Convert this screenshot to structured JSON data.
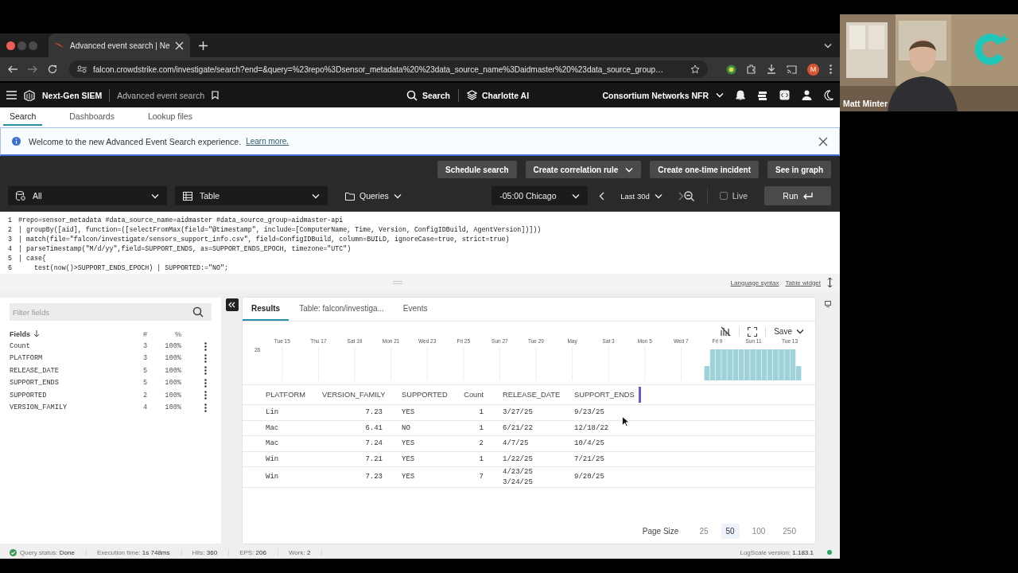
{
  "browser": {
    "tab_title": "Advanced event search | Ne",
    "url": "falcon.crowdstrike.com/investigate/search?end=&query=%23repo%3Dsensor_metadata%20%23data_source_name%3Daidmaster%20%23data_source_group…",
    "profile_initial": "M"
  },
  "app_header": {
    "product": "Next-Gen SIEM",
    "page": "Advanced event search",
    "center_items": [
      {
        "kind": "search",
        "label": "Search"
      },
      {
        "kind": "assistant",
        "label": "Charlotte AI"
      }
    ],
    "organization": "Consortium Networks NFR"
  },
  "nav_tabs": [
    {
      "label": "Search",
      "selected": true
    },
    {
      "label": "Dashboards",
      "selected": false
    },
    {
      "label": "Lookup files",
      "selected": false
    }
  ],
  "banner": {
    "text": "Welcome to the new Advanced Event Search experience.",
    "link": "Learn more."
  },
  "actions": [
    {
      "label": "Schedule search",
      "has_menu": false
    },
    {
      "label": "Create correlation rule",
      "has_menu": true
    },
    {
      "label": "Create one-time incident",
      "has_menu": false
    },
    {
      "label": "See in graph",
      "has_menu": false
    }
  ],
  "query_bar": {
    "repository": "All",
    "view": "Table",
    "queries": "Queries",
    "timezone": "-05:00 Chicago",
    "range": "Last 30d",
    "live": {
      "label": "Live",
      "checked": false
    },
    "run": "Run"
  },
  "editor": {
    "lines": [
      {
        "number": "1",
        "code": "#repo=sensor_metadata #data_source_name=aidmaster #data_source_group=aidmaster-api"
      },
      {
        "number": "2",
        "code": "| groupBy([aid], function=([selectFromMax(field=\"@timestamp\", include=[ComputerName, Time, Version, ConfigIDBuild, AgentVersion])]))"
      },
      {
        "number": "3",
        "code": "| match(file=\"falcon/investigate/sensors_support_info.csv\", field=ConfigIDBuild, column=BUILD, ignoreCase=true, strict=true)"
      },
      {
        "number": "4",
        "code": "| parseTimestamp(\"M/d/yy\",field=SUPPORT_ENDS, as=SUPPORT_ENDS_EPOCH, timezone=\"UTC\")"
      },
      {
        "number": "5",
        "code": "| case{"
      },
      {
        "number": "6",
        "code": "    test(now()>SUPPORT_ENDS_EPOCH) | SUPPORTED:=\"NO\";"
      }
    ]
  },
  "editor_links": [
    "Language syntax",
    "Table widget"
  ],
  "fields_panel": {
    "filter_placeholder": "Filter fields",
    "header": {
      "name": "Fields",
      "count": "#",
      "percent": "%"
    },
    "fields": [
      {
        "name": "Count",
        "count": "3",
        "percent": "100%"
      },
      {
        "name": "PLATFORM",
        "count": "3",
        "percent": "100%"
      },
      {
        "name": "RELEASE_DATE",
        "count": "5",
        "percent": "100%"
      },
      {
        "name": "SUPPORT_ENDS",
        "count": "5",
        "percent": "100%"
      },
      {
        "name": "SUPPORTED",
        "count": "2",
        "percent": "100%"
      },
      {
        "name": "VERSION_FAMILY",
        "count": "4",
        "percent": "100%"
      }
    ]
  },
  "results": {
    "tabs": [
      {
        "label": "Results",
        "selected": true
      },
      {
        "label": "Table: falcon/investiga...",
        "selected": false
      },
      {
        "label": "Events",
        "selected": false
      }
    ],
    "save": "Save",
    "histogram": {
      "y_tick": "26",
      "x_labels": [
        "Tue 15",
        "Thu 17",
        "Sat 19",
        "Mon 21",
        "Wed 23",
        "Fri 25",
        "Sun 27",
        "Tue 29",
        "May",
        "Sat 3",
        "Mon 5",
        "Wed 7",
        "Fri 9",
        "Sun 11",
        "Tue 13"
      ]
    },
    "table": {
      "columns": [
        {
          "label": "PLATFORM",
          "numeric": false
        },
        {
          "label": "VERSION_FAMILY",
          "numeric": true
        },
        {
          "label": "SUPPORTED",
          "numeric": false
        },
        {
          "label": "Count",
          "numeric": true
        },
        {
          "label": "RELEASE_DATE",
          "numeric": false
        },
        {
          "label": "SUPPORT_ENDS",
          "numeric": false
        }
      ],
      "rows": [
        [
          "Lin",
          "7.23",
          "YES",
          "1",
          [
            "3/27/25"
          ],
          "9/23/25"
        ],
        [
          "Mac",
          "6.41",
          "NO",
          "1",
          [
            "6/21/22"
          ],
          "12/18/22"
        ],
        [
          "Mac",
          "7.24",
          "YES",
          "2",
          [
            "4/7/25"
          ],
          "10/4/25"
        ],
        [
          "Win",
          "7.21",
          "YES",
          "1",
          [
            "1/22/25"
          ],
          "7/21/25"
        ],
        [
          "Win",
          "7.23",
          "YES",
          "7",
          [
            "4/23/25",
            "3/24/25"
          ],
          "9/20/25"
        ]
      ]
    },
    "page_size": {
      "label": "Page Size",
      "options": [
        {
          "label": "25",
          "selected": false
        },
        {
          "label": "50",
          "selected": true
        },
        {
          "label": "100",
          "selected": false
        },
        {
          "label": "250",
          "selected": false
        }
      ]
    }
  },
  "status_bar": {
    "items": [
      {
        "kind": "status",
        "text": "Query status: **Done**"
      },
      {
        "kind": "plain",
        "text": "Execution time: **1s 748ms**"
      },
      {
        "kind": "plain",
        "text": "Hits: **360**"
      },
      {
        "kind": "plain",
        "text": "EPS: **206**"
      },
      {
        "kind": "plain",
        "text": "Work: **2**"
      }
    ],
    "version": "LogScale version: **1.183.1**"
  },
  "webcam": {
    "kind": "picture",
    "name": "Matt Minter"
  }
}
